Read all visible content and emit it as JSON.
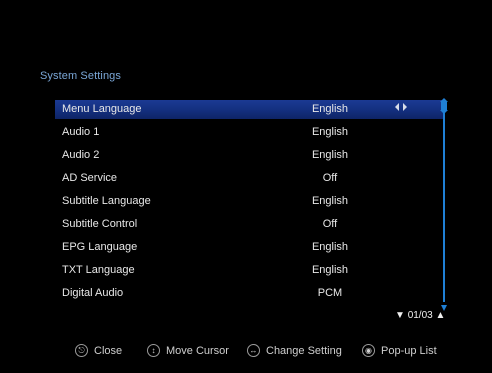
{
  "page": {
    "title": "System Settings"
  },
  "settings": [
    {
      "label": "Menu Language",
      "value": "English",
      "selected": true
    },
    {
      "label": "Audio 1",
      "value": "English"
    },
    {
      "label": "Audio 2",
      "value": "English"
    },
    {
      "label": "AD Service",
      "value": "Off"
    },
    {
      "label": "Subtitle Language",
      "value": "English"
    },
    {
      "label": "Subtitle Control",
      "value": "Off"
    },
    {
      "label": "EPG Language",
      "value": "English"
    },
    {
      "label": "TXT Language",
      "value": "English"
    },
    {
      "label": "Digital Audio",
      "value": "PCM"
    }
  ],
  "selected_indicator_icon": "left-right-arrows-icon",
  "pager": {
    "text": "01/03",
    "down_icon": "triangle-down-icon",
    "up_icon": "triangle-up-icon"
  },
  "footer": {
    "close": {
      "label": "Close",
      "icon": "exit-button-icon"
    },
    "move_cursor": {
      "label": "Move Cursor",
      "icon": "dpad-up-down-icon"
    },
    "change_setting": {
      "label": "Change Setting",
      "icon": "dpad-left-right-icon"
    },
    "popup_list": {
      "label": "Pop-up List",
      "icon": "ok-button-icon"
    }
  },
  "colors": {
    "background": "#000000",
    "title": "#7aa6d6",
    "highlight": "#1b3a93",
    "scrollbar": "#1f80d6",
    "text": "#e8e8e8"
  }
}
